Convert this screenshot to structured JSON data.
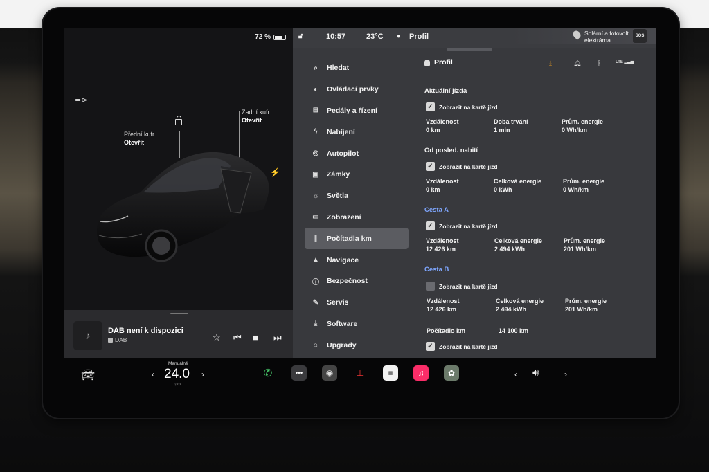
{
  "status": {
    "battery": "72 %",
    "time": "10:57",
    "temperature": "23°C",
    "profile": "Profil",
    "charging_station": "Solární a fotovolt. elektrárna",
    "sos": "SOS"
  },
  "car": {
    "front_trunk_label": "Přední kufr",
    "front_trunk_action": "Otevřít",
    "rear_trunk_label": "Zadní kufr",
    "rear_trunk_action": "Otevřít"
  },
  "media": {
    "title": "DAB není k dispozici",
    "source": "DAB"
  },
  "nav": [
    {
      "label": "Hledat",
      "icon": "search-icon"
    },
    {
      "label": "Ovládací prvky",
      "icon": "toggle-icon"
    },
    {
      "label": "Pedály a řízení",
      "icon": "car-icon"
    },
    {
      "label": "Nabíjení",
      "icon": "bolt-icon"
    },
    {
      "label": "Autopilot",
      "icon": "steering-wheel-icon"
    },
    {
      "label": "Zámky",
      "icon": "lock-icon"
    },
    {
      "label": "Světla",
      "icon": "sun-icon"
    },
    {
      "label": "Zobrazení",
      "icon": "display-icon"
    },
    {
      "label": "Počítadla km",
      "icon": "road-icon",
      "active": true
    },
    {
      "label": "Navigace",
      "icon": "navigation-icon"
    },
    {
      "label": "Bezpečnost",
      "icon": "info-icon"
    },
    {
      "label": "Servis",
      "icon": "wrench-icon"
    },
    {
      "label": "Software",
      "icon": "download-icon"
    },
    {
      "label": "Upgrady",
      "icon": "bag-icon"
    }
  ],
  "content": {
    "profile": "Profil",
    "lte": "LTE",
    "checkbox_label": "Zobrazit na kartě jízd",
    "current_trip": {
      "title": "Aktuální jízda",
      "checked": true,
      "distance_label": "Vzdálenost",
      "distance": "0 km",
      "duration_label": "Doba trvání",
      "duration": "1 min",
      "avg_label": "Prům. energie",
      "avg": "0 Wh/km"
    },
    "since_charge": {
      "title": "Od posled. nabití",
      "checked": true,
      "distance_label": "Vzdálenost",
      "distance": "0 km",
      "energy_label": "Celková energie",
      "energy": "0 kWh",
      "avg_label": "Prům. energie",
      "avg": "0 Wh/km"
    },
    "trip_a": {
      "title": "Cesta A",
      "checked": true,
      "distance_label": "Vzdálenost",
      "distance": "12 426 km",
      "energy_label": "Celková energie",
      "energy": "2 494 kWh",
      "avg_label": "Prům. energie",
      "avg": "201 Wh/km"
    },
    "trip_b": {
      "title": "Cesta B",
      "checked": false,
      "distance_label": "Vzdálenost",
      "distance": "12 426 km",
      "energy_label": "Celková energie",
      "energy": "2 494 kWh",
      "avg_label": "Prům. energie",
      "avg": "201 Wh/km"
    },
    "odometer": {
      "label": "Počítadlo km",
      "value": "14 100 km",
      "checked": true
    }
  },
  "taskbar": {
    "climate_mode": "Manuálně",
    "climate_temp": "24.0",
    "apps": [
      "phone-icon",
      "more-icon",
      "camera-icon",
      "joystick-icon",
      "calendar-icon",
      "music-icon",
      "toybox-icon"
    ]
  }
}
